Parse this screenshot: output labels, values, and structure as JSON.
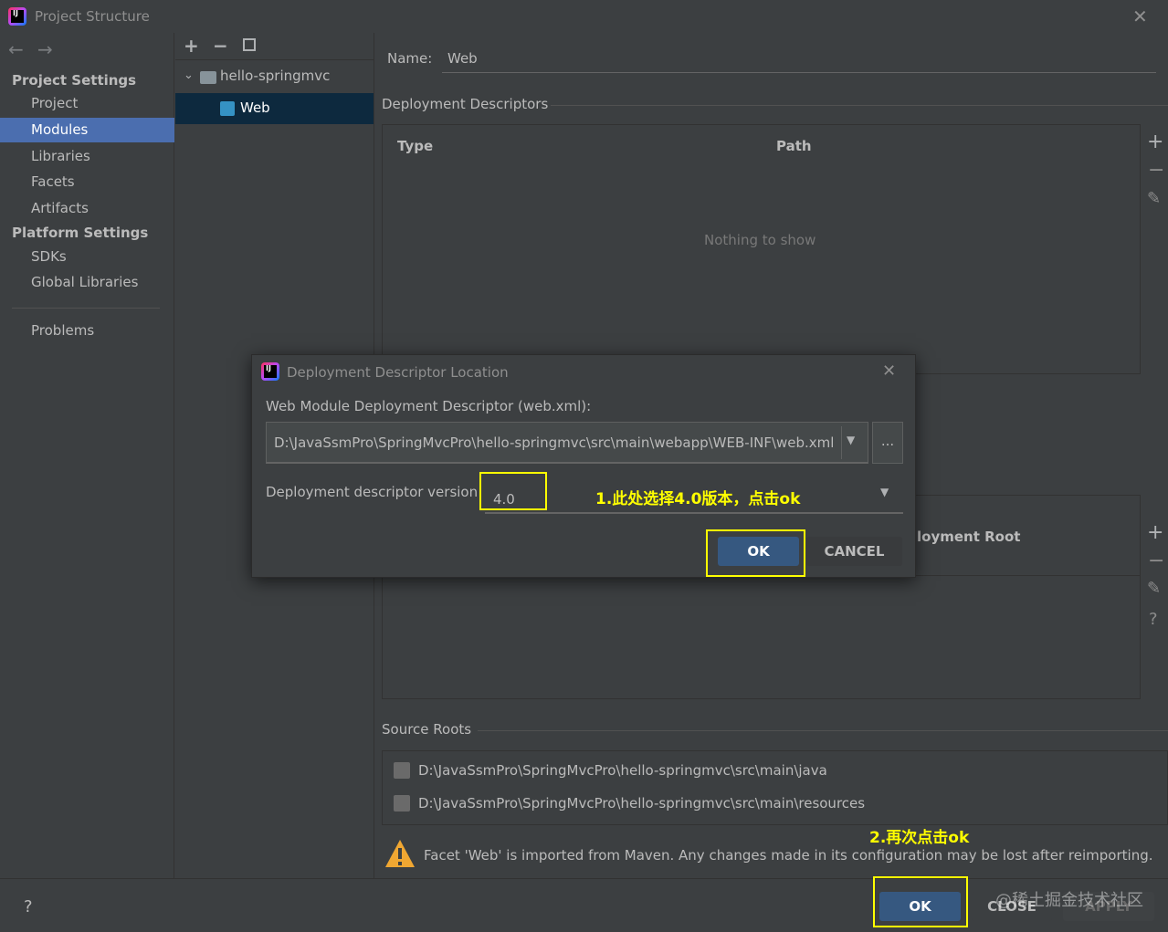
{
  "window": {
    "title": "Project Structure"
  },
  "leftnav": {
    "project_settings": "Project Settings",
    "items_project": [
      "Project",
      "Modules",
      "Libraries",
      "Facets",
      "Artifacts"
    ],
    "platform_settings": "Platform Settings",
    "items_platform": [
      "SDKs",
      "Global Libraries"
    ],
    "problems": "Problems",
    "selected": "Modules"
  },
  "tree": {
    "root": "hello-springmvc",
    "child": "Web"
  },
  "main": {
    "name_label": "Name:",
    "name_value": "Web",
    "deployment_descriptors": "Deployment Descriptors",
    "col_type": "Type",
    "col_path": "Path",
    "empty_text": "Nothing to show",
    "partial_column": "loyment Root",
    "source_roots": "Source Roots",
    "source_items": [
      "D:\\JavaSsmPro\\SpringMvcPro\\hello-springmvc\\src\\main\\java",
      "D:\\JavaSsmPro\\SpringMvcPro\\hello-springmvc\\src\\main\\resources"
    ],
    "warning": "Facet 'Web' is imported from Maven. Any changes made in its configuration may be lost after reimporting."
  },
  "dialog": {
    "title": "Deployment Descriptor Location",
    "path_label": "Web Module Deployment Descriptor (web.xml):",
    "path_value": "D:\\JavaSsmPro\\SpringMvcPro\\hello-springmvc\\src\\main\\webapp\\WEB-INF\\web.xml",
    "browse": "...",
    "version_label": "Deployment descriptor version",
    "version_value": "4.0",
    "ok": "OK",
    "cancel": "CANCEL"
  },
  "annotations": {
    "step1": "1.此处选择4.0版本，点击ok",
    "step2": "2.再次点击ok"
  },
  "footer": {
    "help": "?",
    "ok": "OK",
    "close": "CLOSE",
    "apply": "APPLY",
    "watermark": "@稀土掘金技术社区"
  },
  "colors": {
    "background": "#3c3f41",
    "selection": "#4b6eaf",
    "primary_button": "#365880",
    "highlight": "#ffff00",
    "warning": "#f0a732"
  }
}
